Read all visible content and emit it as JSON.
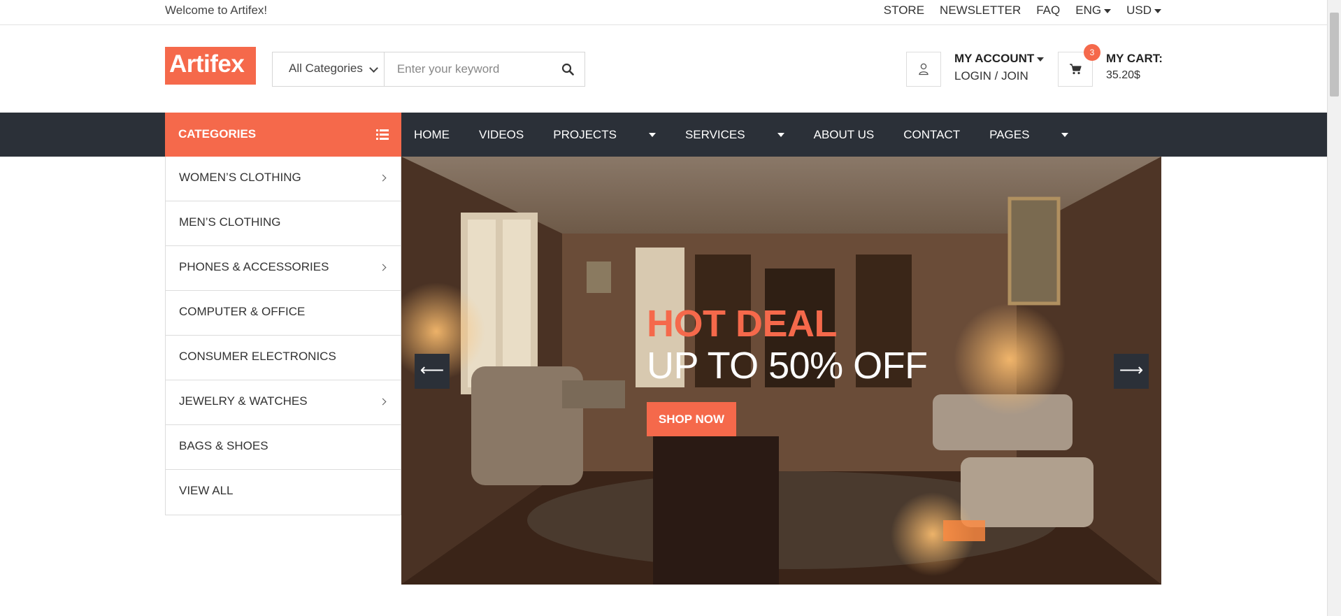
{
  "topbar": {
    "welcome": "Welcome to Artifex!",
    "links": [
      "STORE",
      "NEWSLETTER",
      "FAQ"
    ],
    "language": "ENG",
    "currency": "USD"
  },
  "header": {
    "logo": "Artifex",
    "search": {
      "category": "All Categories",
      "placeholder": "Enter your keyword",
      "value": ""
    },
    "account": {
      "title": "MY ACCOUNT",
      "subtitle": "LOGIN / JOIN"
    },
    "cart": {
      "title": "MY CART:",
      "amount": "35.20$",
      "count": "3"
    }
  },
  "nav": {
    "categories_label": "CATEGORIES",
    "items": [
      {
        "label": "HOME",
        "dropdown": false
      },
      {
        "label": "VIDEOS",
        "dropdown": false
      },
      {
        "label": "PROJECTS",
        "dropdown": true
      },
      {
        "label": "SERVICES",
        "dropdown": true
      },
      {
        "label": "ABOUT US",
        "dropdown": false
      },
      {
        "label": "CONTACT",
        "dropdown": false
      },
      {
        "label": "PAGES",
        "dropdown": true
      }
    ]
  },
  "sidebar": {
    "items": [
      {
        "label": "WOMEN’S CLOTHING",
        "has_sub": true
      },
      {
        "label": "MEN’S CLOTHING",
        "has_sub": false
      },
      {
        "label": "PHONES & ACCESSORIES",
        "has_sub": true
      },
      {
        "label": "COMPUTER & OFFICE",
        "has_sub": false
      },
      {
        "label": "CONSUMER ELECTRONICS",
        "has_sub": false
      },
      {
        "label": "JEWELRY & WATCHES",
        "has_sub": true
      },
      {
        "label": "BAGS & SHOES",
        "has_sub": false
      },
      {
        "label": "VIEW ALL",
        "has_sub": false
      }
    ]
  },
  "hero": {
    "title": "HOT DEAL",
    "subtitle": "UP TO 50% OFF",
    "button": "SHOP NOW",
    "prev": "⟵",
    "next": "⟶"
  },
  "colors": {
    "accent": "#f5694b",
    "navbar": "#2b3038"
  }
}
